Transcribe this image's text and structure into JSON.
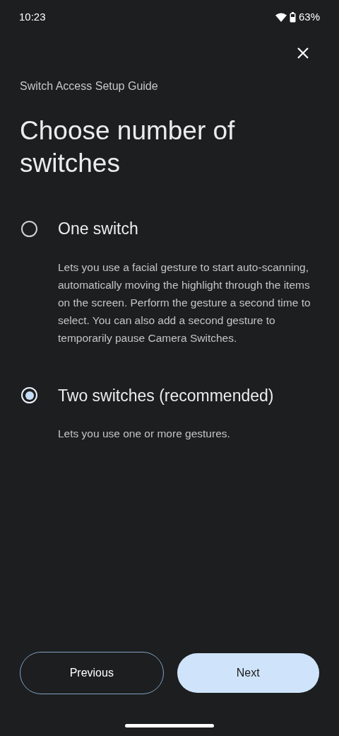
{
  "status_bar": {
    "time": "10:23",
    "battery": "63%"
  },
  "subtitle": "Switch Access Setup Guide",
  "title": "Choose number of switches",
  "options": [
    {
      "label": "One switch",
      "description": "Lets you use a facial gesture to start auto-scanning, automatically moving the highlight through the items on the screen. Perform the gesture a second time to select. You can also add a second gesture to temporarily pause Camera Switches.",
      "selected": false
    },
    {
      "label": "Two switches (recommended)",
      "description": "Lets you use one or more gestures.",
      "selected": true
    }
  ],
  "buttons": [
    {
      "label": "Previous",
      "kind": "outlined"
    },
    {
      "label": "Next",
      "kind": "filled"
    }
  ]
}
